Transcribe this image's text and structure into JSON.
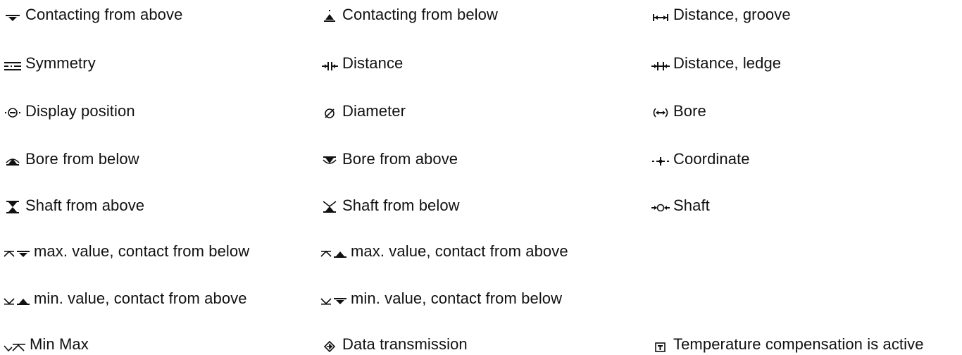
{
  "legend": {
    "items": [
      {
        "label": "Contacting from above",
        "icon": "contact-from-above-icon"
      },
      {
        "label": "Contacting from below",
        "icon": "contact-from-below-icon"
      },
      {
        "label": "Distance, groove",
        "icon": "distance-groove-icon"
      },
      {
        "label": "Symmetry",
        "icon": "symmetry-icon"
      },
      {
        "label": "Distance",
        "icon": "distance-icon"
      },
      {
        "label": "Distance, ledge",
        "icon": "distance-ledge-icon"
      },
      {
        "label": "Display position",
        "icon": "display-position-icon"
      },
      {
        "label": "Diameter",
        "icon": "diameter-icon"
      },
      {
        "label": "Bore",
        "icon": "bore-icon"
      },
      {
        "label": "Bore from below",
        "icon": "bore-from-below-icon"
      },
      {
        "label": "Bore from above",
        "icon": "bore-from-above-icon"
      },
      {
        "label": "Coordinate",
        "icon": "coordinate-icon"
      },
      {
        "label": "Shaft from above",
        "icon": "shaft-from-above-icon"
      },
      {
        "label": "Shaft from below",
        "icon": "shaft-from-below-icon"
      },
      {
        "label": "Shaft",
        "icon": "shaft-icon"
      },
      {
        "label": "max. value, contact from below",
        "icon": "max-contact-below-icon"
      },
      {
        "label": "max. value, contact from above",
        "icon": "max-contact-above-icon"
      },
      {
        "label": "min. value, contact from above",
        "icon": "min-contact-above-icon"
      },
      {
        "label": "min. value, contact from below",
        "icon": "min-contact-below-icon"
      },
      {
        "label": "Min Max",
        "icon": "min-max-icon"
      },
      {
        "label": "Data transmission",
        "icon": "data-transmission-icon"
      },
      {
        "label": "Temperature compensation is active",
        "icon": "temperature-compensation-icon"
      }
    ]
  }
}
